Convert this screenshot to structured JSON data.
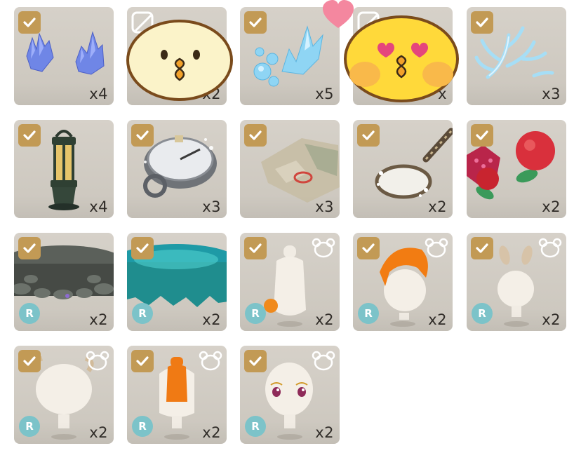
{
  "items": [
    {
      "id": "blue-crystals",
      "quantity": "x4",
      "checked": true,
      "rare": false,
      "wearable": false
    },
    {
      "id": "light-orb",
      "quantity": "x2",
      "checked": false,
      "rare": false,
      "wearable": false
    },
    {
      "id": "ice-crystals",
      "quantity": "x5",
      "checked": true,
      "rare": false,
      "wearable": false
    },
    {
      "id": "hidden-item",
      "quantity": "x",
      "checked": false,
      "rare": false,
      "wearable": false
    },
    {
      "id": "frost-coral",
      "quantity": "x3",
      "checked": true,
      "rare": false,
      "wearable": false
    },
    {
      "id": "lantern",
      "quantity": "x4",
      "checked": true,
      "rare": false,
      "wearable": false
    },
    {
      "id": "frosted-compass",
      "quantity": "x3",
      "checked": true,
      "rare": false,
      "wearable": false
    },
    {
      "id": "treasure-map",
      "quantity": "x3",
      "checked": true,
      "rare": false,
      "wearable": false
    },
    {
      "id": "frosted-magnifying-glass",
      "quantity": "x2",
      "checked": true,
      "rare": false,
      "wearable": false
    },
    {
      "id": "pomegranates",
      "quantity": "x2",
      "checked": true,
      "rare": false,
      "wearable": false
    },
    {
      "id": "stone-platform",
      "quantity": "x2",
      "checked": true,
      "rare": true,
      "rare_label": "R",
      "wearable": false
    },
    {
      "id": "teal-platform",
      "quantity": "x2",
      "checked": true,
      "rare": true,
      "rare_label": "R",
      "wearable": false
    },
    {
      "id": "hair-bun-orange-tie",
      "quantity": "x2",
      "checked": true,
      "rare": true,
      "rare_label": "R",
      "wearable": true
    },
    {
      "id": "orange-bob-hair",
      "quantity": "x2",
      "checked": true,
      "rare": true,
      "rare_label": "R",
      "wearable": true
    },
    {
      "id": "bunny-ear-hair",
      "quantity": "x2",
      "checked": true,
      "rare": true,
      "rare_label": "R",
      "wearable": true
    },
    {
      "id": "horned-hair",
      "quantity": "x2",
      "checked": true,
      "rare": true,
      "rare_label": "R",
      "wearable": true
    },
    {
      "id": "orange-braid-hair",
      "quantity": "x2",
      "checked": true,
      "rare": true,
      "rare_label": "R",
      "wearable": true
    },
    {
      "id": "doll-face",
      "quantity": "x2",
      "checked": true,
      "rare": true,
      "rare_label": "R",
      "wearable": true
    }
  ],
  "colors": {
    "tile": "#cfcac2",
    "check": "#c29a55",
    "rare_badge": "#7cc3c9",
    "quantity_text": "#2f2b27"
  }
}
